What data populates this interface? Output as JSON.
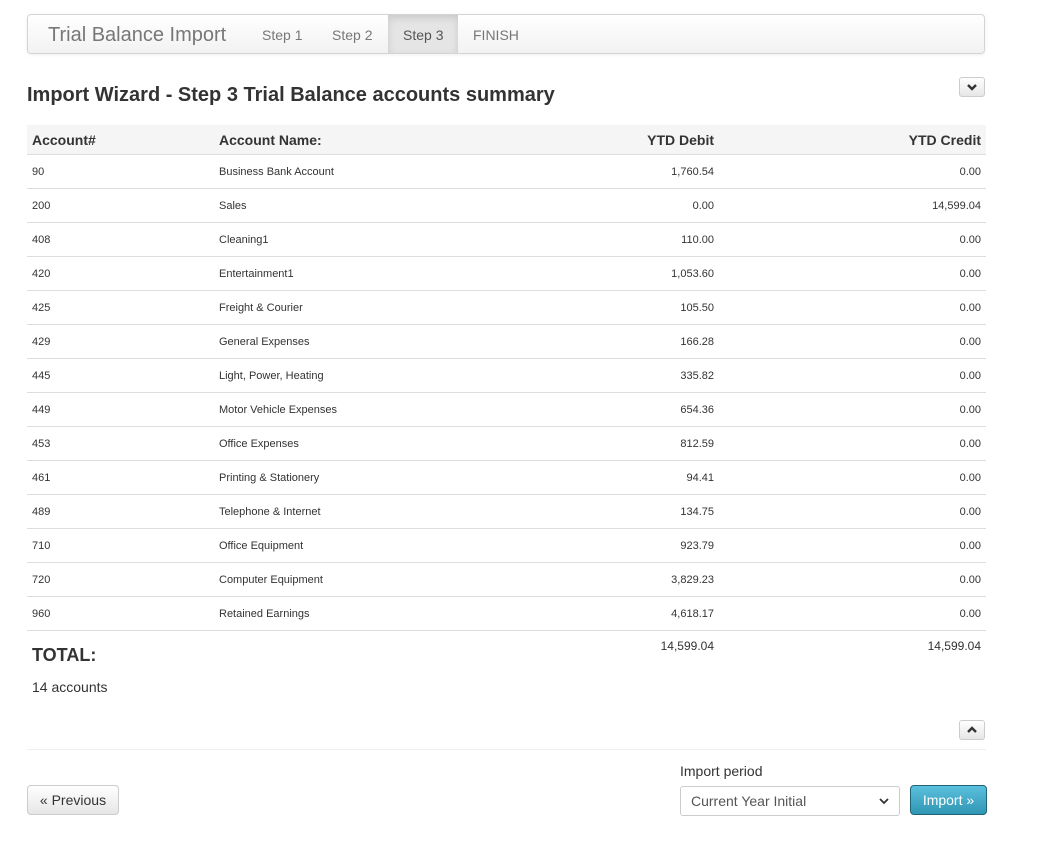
{
  "navbar": {
    "brand": "Trial Balance Import",
    "tabs": [
      {
        "label": "Step 1"
      },
      {
        "label": "Step 2"
      },
      {
        "label": "Step 3"
      },
      {
        "label": "FINISH"
      }
    ],
    "active_tab": "Step 3"
  },
  "page": {
    "title": "Import Wizard - Step 3 Trial Balance accounts summary",
    "collapse_icon": "chevron-down-icon",
    "expand_icon": "chevron-up-icon"
  },
  "table": {
    "headers": {
      "account": "Account#",
      "name": "Account Name:",
      "debit": "YTD Debit",
      "credit": "YTD Credit"
    },
    "rows": [
      {
        "account": "90",
        "name": "Business Bank Account",
        "debit": "1,760.54",
        "credit": "0.00"
      },
      {
        "account": "200",
        "name": "Sales",
        "debit": "0.00",
        "credit": "14,599.04"
      },
      {
        "account": "408",
        "name": "Cleaning1",
        "debit": "110.00",
        "credit": "0.00"
      },
      {
        "account": "420",
        "name": "Entertainment1",
        "debit": "1,053.60",
        "credit": "0.00"
      },
      {
        "account": "425",
        "name": "Freight & Courier",
        "debit": "105.50",
        "credit": "0.00"
      },
      {
        "account": "429",
        "name": "General Expenses",
        "debit": "166.28",
        "credit": "0.00"
      },
      {
        "account": "445",
        "name": "Light, Power, Heating",
        "debit": "335.82",
        "credit": "0.00"
      },
      {
        "account": "449",
        "name": "Motor Vehicle Expenses",
        "debit": "654.36",
        "credit": "0.00"
      },
      {
        "account": "453",
        "name": "Office Expenses",
        "debit": "812.59",
        "credit": "0.00"
      },
      {
        "account": "461",
        "name": "Printing & Stationery",
        "debit": "94.41",
        "credit": "0.00"
      },
      {
        "account": "489",
        "name": "Telephone & Internet",
        "debit": "134.75",
        "credit": "0.00"
      },
      {
        "account": "710",
        "name": "Office Equipment",
        "debit": "923.79",
        "credit": "0.00"
      },
      {
        "account": "720",
        "name": "Computer Equipment",
        "debit": "3,829.23",
        "credit": "0.00"
      },
      {
        "account": "960",
        "name": "Retained Earnings",
        "debit": "4,618.17",
        "credit": "0.00"
      }
    ],
    "total": {
      "label": "TOTAL:",
      "count": "14 accounts",
      "debit": "14,599.04",
      "credit": "14,599.04"
    }
  },
  "footer": {
    "previous_label": "« Previous",
    "import_period_label": "Import period",
    "import_period_value": "Current Year Initial",
    "import_label": "Import »"
  },
  "colors": {
    "import_button": "#31b0d5",
    "navbar_active": "#e5e5e5"
  }
}
